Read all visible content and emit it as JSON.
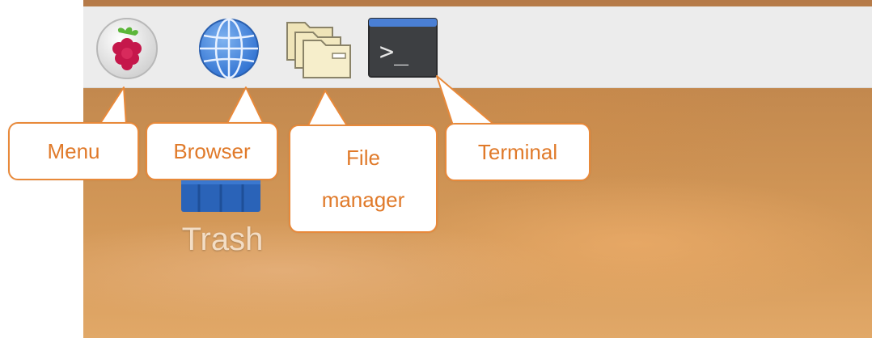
{
  "taskbar": {
    "icons": [
      {
        "name": "raspberry-menu-icon"
      },
      {
        "name": "globe-browser-icon"
      },
      {
        "name": "folder-file-manager-icon"
      },
      {
        "name": "terminal-icon",
        "glyph": ">_"
      }
    ]
  },
  "callouts": {
    "menu": "Menu",
    "browser": "Browser",
    "file_manager_line1": "File",
    "file_manager_line2": "manager",
    "terminal": "Terminal"
  },
  "desktop": {
    "trash_label": "Trash"
  },
  "colors": {
    "callout_border": "#e8893a",
    "callout_text": "#e07a2a",
    "taskbar_bg": "#ececec",
    "terminal_bar": "#4a7fd4",
    "terminal_body": "#3d3f42"
  }
}
